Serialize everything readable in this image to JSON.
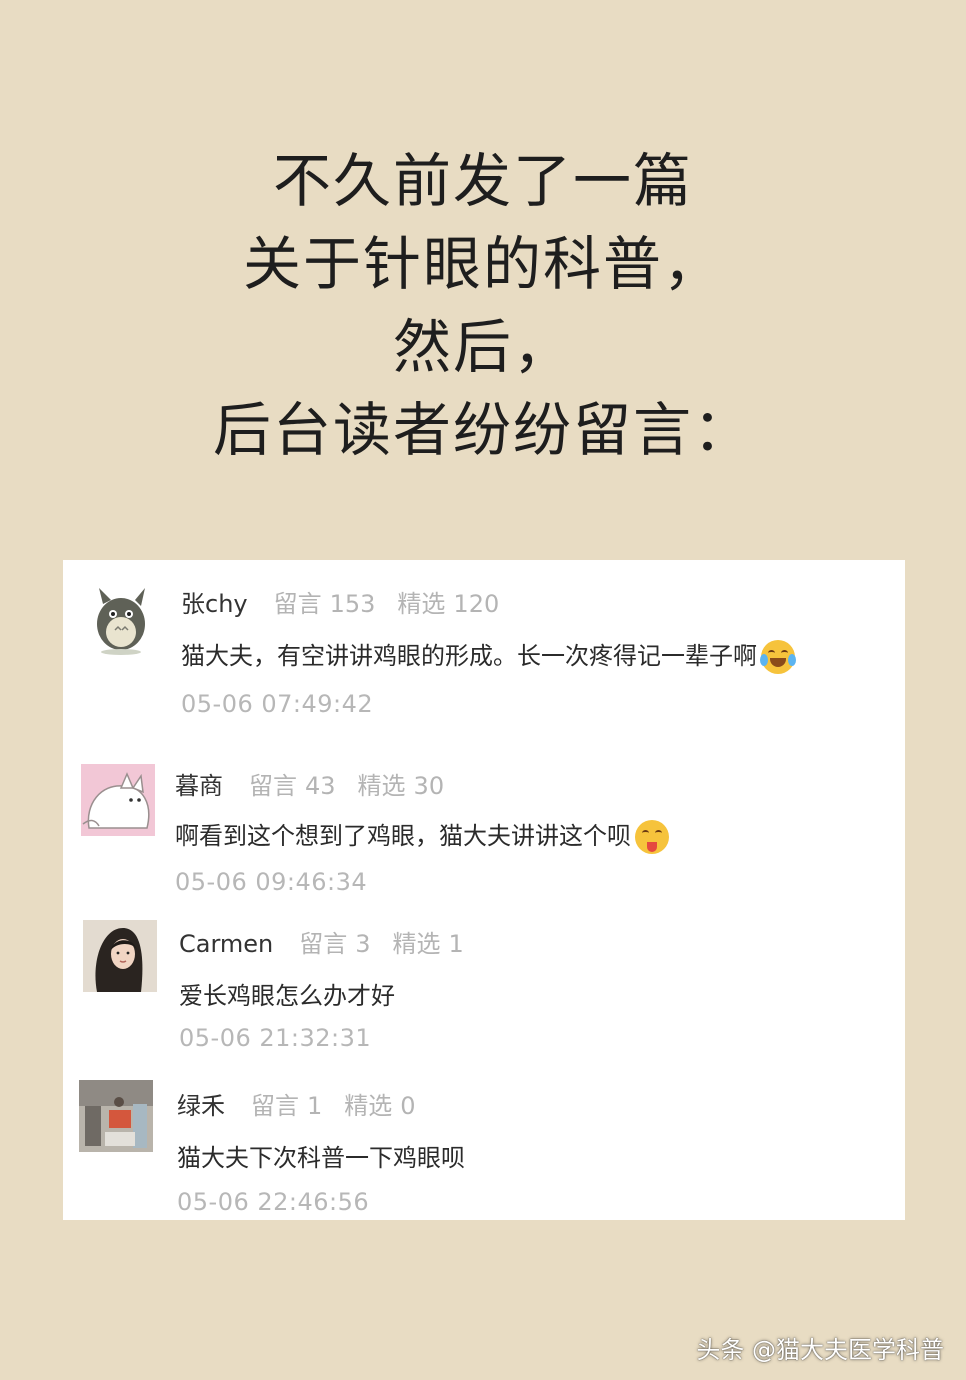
{
  "headline": {
    "lines": [
      "不久前发了一篇",
      "关于针眼的科普，",
      "然后，",
      "后台读者纷纷留言："
    ]
  },
  "comments": [
    {
      "name": "张chy",
      "messages_label": "留言",
      "messages_count": "153",
      "featured_label": "精选",
      "featured_count": "120",
      "text": "猫大夫，有空讲讲鸡眼的形成。长一次疼得记一辈子啊",
      "emoji": "laughing-crying-emoji",
      "time": "05-06 07:49:42"
    },
    {
      "name": "暮商",
      "messages_label": "留言",
      "messages_count": "43",
      "featured_label": "精选",
      "featured_count": "30",
      "text": "啊看到这个想到了鸡眼，猫大夫讲讲这个呗",
      "emoji": "tongue-wink-emoji",
      "time": "05-06 09:46:34"
    },
    {
      "name": "Carmen",
      "messages_label": "留言",
      "messages_count": "3",
      "featured_label": "精选",
      "featured_count": "1",
      "text": "爱长鸡眼怎么办才好",
      "emoji": "",
      "time": "05-06 21:32:31"
    },
    {
      "name": "绿禾",
      "messages_label": "留言",
      "messages_count": "1",
      "featured_label": "精选",
      "featured_count": "0",
      "text": "猫大夫下次科普一下鸡眼呗",
      "emoji": "",
      "time": "05-06 22:46:56"
    }
  ],
  "watermark": "头条 @猫大夫医学科普",
  "colors": {
    "page_background": "#e8dcc3",
    "card_background": "#ffffff",
    "name_text": "#333333",
    "stat_text": "#b4b4b4",
    "time_text": "#b7b7b7"
  }
}
